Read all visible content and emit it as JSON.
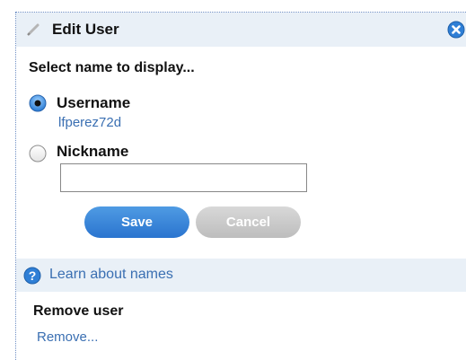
{
  "dialog": {
    "title": "Edit User",
    "prompt": "Select name to display...",
    "options": [
      {
        "label": "Username",
        "value": "lfperez72d",
        "selected": true
      },
      {
        "label": "Nickname",
        "value": "",
        "selected": false
      }
    ],
    "nickname_placeholder": "",
    "save_label": "Save",
    "cancel_label": "Cancel"
  },
  "help": {
    "link_text": "Learn about names"
  },
  "remove": {
    "heading": "Remove user",
    "link_text": "Remove..."
  },
  "colors": {
    "header_bg": "#e9f0f7",
    "link": "#3a6fb2",
    "save_button": "#2a74cf",
    "cancel_button": "#c4c4c4",
    "close_icon": "#2f7fd6"
  },
  "icons": {
    "header": "pencil-icon",
    "close": "close-icon",
    "help": "help-icon"
  }
}
